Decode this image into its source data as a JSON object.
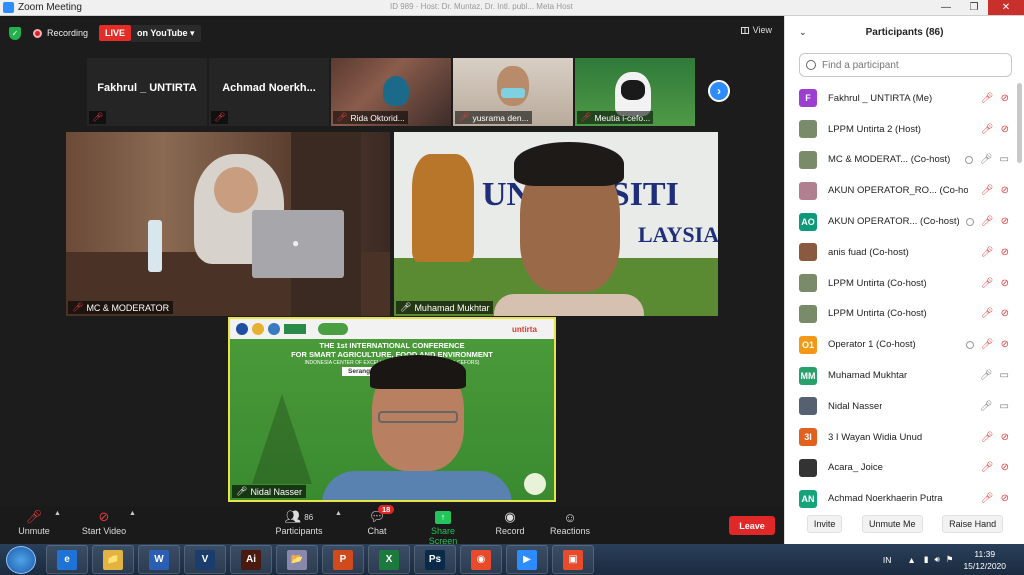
{
  "window": {
    "title": "Zoom Meeting",
    "center_title": "ID 989  ·  Host: Dr. Muntaz, Dr. Intl. publ...  Meta Host"
  },
  "topbar": {
    "recording_label": "Recording",
    "live_label": "LIVE",
    "youtube_label": "on YouTube ▾",
    "view_label": "View"
  },
  "gallery": [
    {
      "name": "Fakhrul _ UNTIRTA",
      "label": "",
      "muted": true
    },
    {
      "name": "Achmad  Noerkh...",
      "label": "",
      "muted": true
    },
    {
      "name": "",
      "label": "Rida Oktorid...",
      "muted": true
    },
    {
      "name": "",
      "label": "yusrama den...",
      "muted": true
    },
    {
      "name": "",
      "label": "Meutia i-cefo...",
      "muted": true
    }
  ],
  "videos": {
    "mc": "MC & MODERATOR",
    "muhamad": "Muhamad Mukhtar",
    "nidal": "Nidal Nasser",
    "banner_line1": "THE 1st INTERNATIONAL CONFERENCE",
    "banner_line2": "FOR SMART AGRICULTURE, FOOD AND ENVIRONMENT",
    "banner_line3": "INDONESIA CENTER OF EXCELLENCE FOR FOOD SECURITY (I-CEFORS)",
    "banner_place": "Serang, 15",
    "banner_brand": "untirta",
    "sign_text": "UN    VERSITI",
    "sign_text2": "S",
    "sign_text3": "LAYSIA"
  },
  "toolbar": {
    "unmute": "Unmute",
    "start_video": "Start Video",
    "participants": "Participants",
    "participants_count": "86",
    "chat": "Chat",
    "chat_badge": "18",
    "share": "Share Screen",
    "record": "Record",
    "reactions": "Reactions",
    "leave": "Leave"
  },
  "panel": {
    "title": "Participants (86)",
    "search_placeholder": "Find a participant",
    "participants": [
      {
        "name": "Fakhrul _ UNTIRTA (Me)",
        "avatar": "F",
        "color": "#9b3fd1",
        "mic": "muted",
        "video": "off",
        "rec": false
      },
      {
        "name": "LPPM Untirta 2 (Host)",
        "avatar": "",
        "color": "#7a8b6a",
        "mic": "muted",
        "video": "off",
        "rec": false
      },
      {
        "name": "MC & MODERAT...  (Co-host)",
        "avatar": "",
        "color": "#7a8b6a",
        "mic": "on",
        "video": "on",
        "rec": true
      },
      {
        "name": "AKUN OPERATOR_RO... (Co-host)",
        "avatar": "",
        "color": "#b08090",
        "mic": "muted",
        "video": "off",
        "rec": false
      },
      {
        "name": "AKUN OPERATOR...  (Co-host)",
        "avatar": "AO",
        "color": "#0e9a7a",
        "mic": "muted",
        "video": "off",
        "rec": true
      },
      {
        "name": "anis fuad (Co-host)",
        "avatar": "",
        "color": "#8a5a40",
        "mic": "muted",
        "video": "off",
        "rec": false
      },
      {
        "name": "LPPM Untirta (Co-host)",
        "avatar": "",
        "color": "#7a8b6a",
        "mic": "muted",
        "video": "off",
        "rec": false
      },
      {
        "name": "LPPM Untirta (Co-host)",
        "avatar": "",
        "color": "#7a8b6a",
        "mic": "muted",
        "video": "off",
        "rec": false
      },
      {
        "name": "Operator 1 (Co-host)",
        "avatar": "O1",
        "color": "#f29a18",
        "mic": "muted",
        "video": "off",
        "rec": true
      },
      {
        "name": "Muhamad Mukhtar",
        "avatar": "MM",
        "color": "#27a06a",
        "mic": "on",
        "video": "on",
        "rec": false
      },
      {
        "name": "Nidal Nasser",
        "avatar": "",
        "color": "#556070",
        "mic": "on",
        "video": "on",
        "rec": false
      },
      {
        "name": "3 I Wayan Widia Unud",
        "avatar": "3I",
        "color": "#e0601e",
        "mic": "muted",
        "video": "off",
        "rec": false
      },
      {
        "name": "Acara_ Joice",
        "avatar": "",
        "color": "#333333",
        "mic": "muted",
        "video": "off",
        "rec": false
      },
      {
        "name": "Achmad Noerkhaerin Putra",
        "avatar": "AN",
        "color": "#14a37a",
        "mic": "muted",
        "video": "off",
        "rec": false
      }
    ],
    "invite": "Invite",
    "unmute_me": "Unmute Me",
    "raise_hand": "Raise Hand"
  },
  "taskbar": {
    "apps": [
      "e",
      "📁",
      "W",
      "V",
      "Ai",
      "📂",
      "P",
      "X",
      "Ps",
      "◉",
      "▶",
      "▣"
    ],
    "app_colors": [
      "#1e73d6",
      "#e3b341",
      "#2b5fb4",
      "#1a3d6e",
      "#4a1a10",
      "#88a",
      "#d04a1e",
      "#1d7a3f",
      "#0b2a4a",
      "#e84a2c",
      "#2d8cff",
      "#e84a2c"
    ],
    "lang": "IN",
    "time": "11:39",
    "date": "15/12/2020"
  }
}
